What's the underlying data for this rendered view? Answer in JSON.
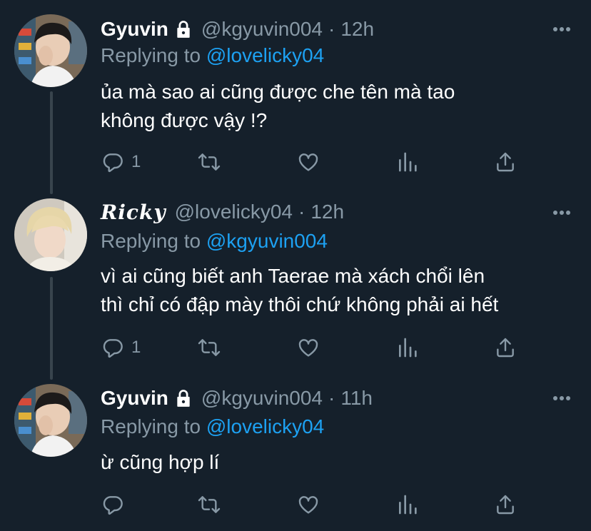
{
  "tweets": [
    {
      "display_name": "Gyuvin",
      "verified_lock": true,
      "handle": "@kgyuvin004",
      "separator": "·",
      "time": "12h",
      "replying_prefix": "Replying to",
      "replying_to": "@lovelicky04",
      "lines": [
        "ủa mà sao ai cũng được che tên mà tao",
        "không được vậy !?"
      ],
      "reply_count": "1"
    },
    {
      "display_name": "Ricky",
      "verified_lock": false,
      "handle": "@lovelicky04",
      "separator": "·",
      "time": "12h",
      "replying_prefix": "Replying to",
      "replying_to": "@kgyuvin004",
      "lines": [
        "vì ai cũng biết anh Taerae mà xách chổi lên",
        "thì chỉ có đập mày thôi chứ không phải ai hết"
      ],
      "reply_count": "1"
    },
    {
      "display_name": "Gyuvin",
      "verified_lock": true,
      "handle": "@kgyuvin004",
      "separator": "·",
      "time": "11h",
      "replying_prefix": "Replying to",
      "replying_to": "@lovelicky04",
      "lines": [
        "ừ cũng hợp lí"
      ],
      "reply_count": ""
    }
  ],
  "colors": {
    "background": "#15202b",
    "secondary_text": "#8899a6",
    "mention": "#1da1f2",
    "thread_line": "#38444d"
  },
  "icons": [
    "reply-icon",
    "retweet-icon",
    "like-icon",
    "analytics-icon",
    "share-icon",
    "more-icon",
    "lock-icon"
  ]
}
